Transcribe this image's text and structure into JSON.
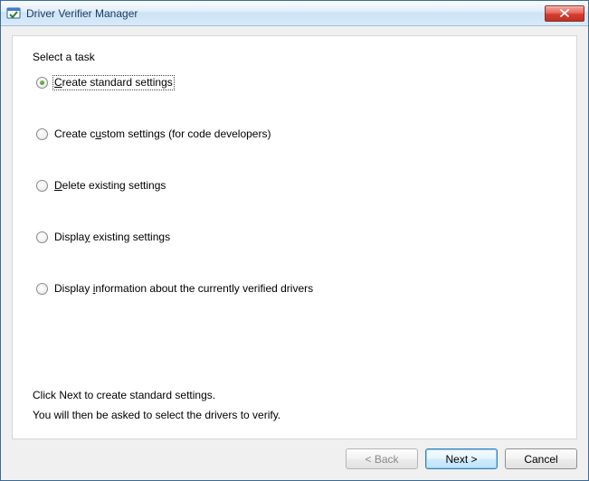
{
  "window": {
    "title": "Driver Verifier Manager"
  },
  "panel": {
    "group_label": "Select a task",
    "options": [
      {
        "label_pre": "",
        "accel": "C",
        "label_post": "reate standard settings",
        "selected": true
      },
      {
        "label_pre": "Create c",
        "accel": "u",
        "label_post": "stom settings (for code developers)",
        "selected": false
      },
      {
        "label_pre": "",
        "accel": "D",
        "label_post": "elete existing settings",
        "selected": false
      },
      {
        "label_pre": "Displa",
        "accel": "y",
        "label_post": " existing settings",
        "selected": false
      },
      {
        "label_pre": "Display ",
        "accel": "i",
        "label_post": "nformation about the currently verified drivers",
        "selected": false
      }
    ],
    "help_line1": "Click Next to create standard settings.",
    "help_line2": "You will then be asked to select the drivers to verify."
  },
  "buttons": {
    "back": "< Back",
    "next": "Next >",
    "cancel": "Cancel"
  }
}
